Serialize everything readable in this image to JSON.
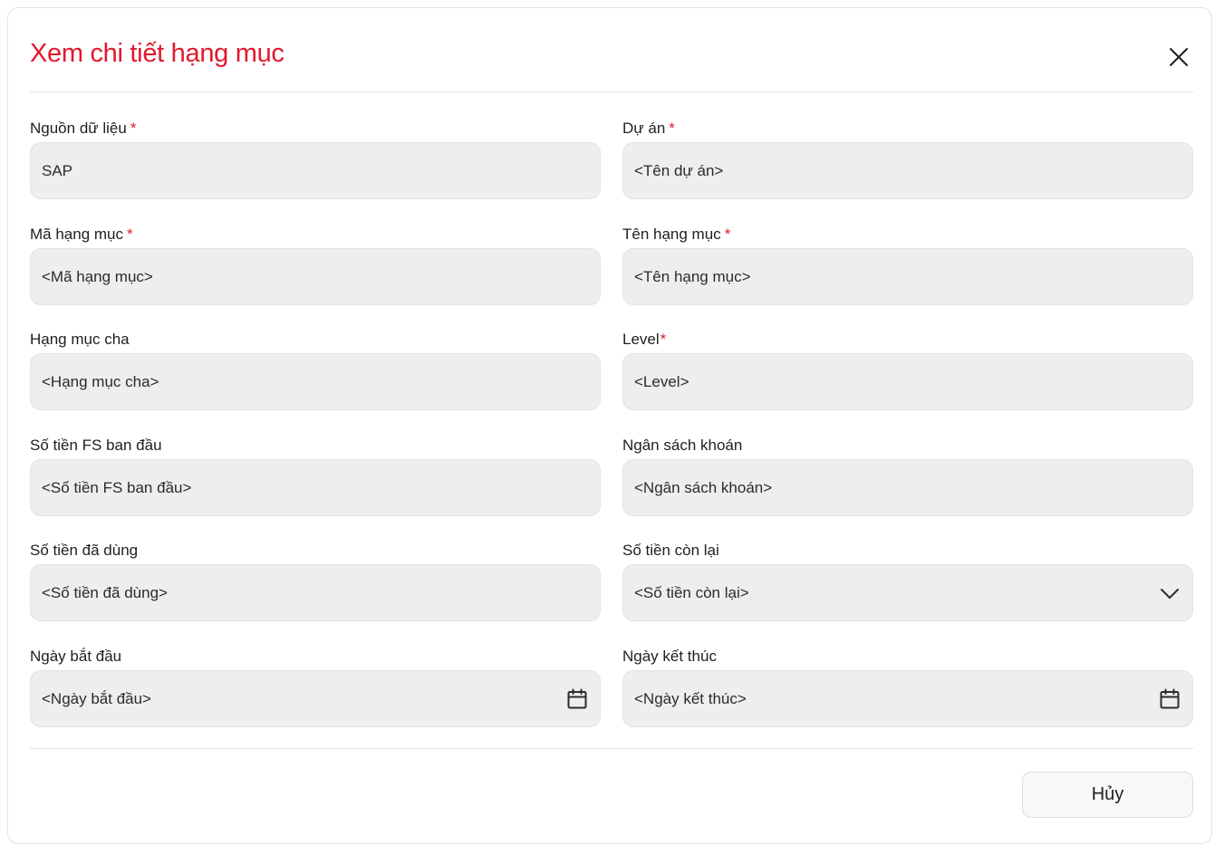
{
  "dialog": {
    "title": "Xem chi tiết hạng mục",
    "cancel_label": "Hủy",
    "required_marker": "*",
    "accent_color": "#e3182d"
  },
  "fields": {
    "source": {
      "label": "Nguồn dữ liệu",
      "value": "SAP",
      "required": true
    },
    "project": {
      "label": "Dự án",
      "value": "<Tên dự án>",
      "required": true
    },
    "code": {
      "label": "Mã hạng mục",
      "value": "<Mã hạng mục>",
      "required": true
    },
    "name": {
      "label": "Tên hạng mục",
      "value": "<Tên hạng mục>",
      "required": true
    },
    "parent": {
      "label": "Hạng mục cha",
      "value": "<Hạng mục cha>",
      "required": false
    },
    "level": {
      "label": "Level",
      "value": "<Level>",
      "required": true
    },
    "fs_initial": {
      "label": "Số tiền FS ban đầu",
      "value": "<Số tiền FS ban đầu>",
      "required": false
    },
    "budget": {
      "label": "Ngân sách khoán",
      "value": "<Ngân sách khoán>",
      "required": false
    },
    "used": {
      "label": "Số tiền đã dùng",
      "value": "<Số tiền đã dùng>",
      "required": false
    },
    "remaining": {
      "label": "Số tiền còn lại",
      "value": "<Số tiền còn lại>",
      "required": false,
      "icon": "chevron-down-icon"
    },
    "start_date": {
      "label": "Ngày bắt đầu",
      "value": "<Ngày bắt đầu>",
      "required": false,
      "icon": "calendar-icon"
    },
    "end_date": {
      "label": "Ngày kết thúc",
      "value": "<Ngày kết thúc>",
      "required": false,
      "icon": "calendar-icon"
    }
  }
}
